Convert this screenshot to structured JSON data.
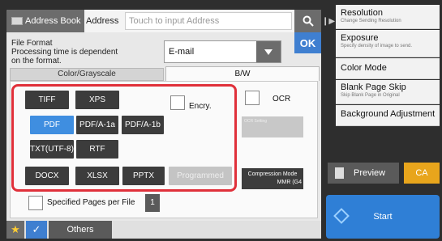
{
  "topbar": {
    "address_book_label": "Address Book",
    "address_label": "Address",
    "address_placeholder": "Touch to input Address"
  },
  "file_format": {
    "label": "File Format\nProcessing time is dependent\non the format.",
    "selected": "E-mail",
    "ok_label": "OK"
  },
  "tabs": {
    "color": "Color/Grayscale",
    "bw": "B/W"
  },
  "formats": {
    "tiff": "TIFF",
    "xps": "XPS",
    "pdf": "PDF",
    "pdfa1a": "PDF/A-1a",
    "pdfa1b": "PDF/A-1b",
    "txt": "TXT(UTF-8)",
    "rtf": "RTF",
    "docx": "DOCX",
    "xlsx": "XLSX",
    "pptx": "PPTX",
    "programmed": "Programmed",
    "selected_color": "#3f8ee0"
  },
  "options": {
    "encry": "Encry.",
    "ocr": "OCR",
    "ocr_setting": "OCR Setting",
    "compression_mode": "Compression Mode",
    "compression_value": "MMR (G4",
    "specified_pages": "Specified Pages per File",
    "pages_value": "1"
  },
  "bottombar": {
    "others": "Others"
  },
  "right_menu": [
    {
      "title": "Resolution",
      "sub": "Change Sending Resolution"
    },
    {
      "title": "Exposure",
      "sub": "Specify density of image to send."
    },
    {
      "title": "Color Mode",
      "sub": ""
    },
    {
      "title": "Blank Page Skip",
      "sub": "Skip Blank Page in Original"
    },
    {
      "title": "Background Adjustment",
      "sub": ""
    }
  ],
  "actions": {
    "preview": "Preview",
    "ca": "CA",
    "start": "Start"
  },
  "colors": {
    "accent_blue": "#3f7fd0",
    "highlight_red": "#e0303a",
    "ca_orange": "#e8a51c"
  }
}
